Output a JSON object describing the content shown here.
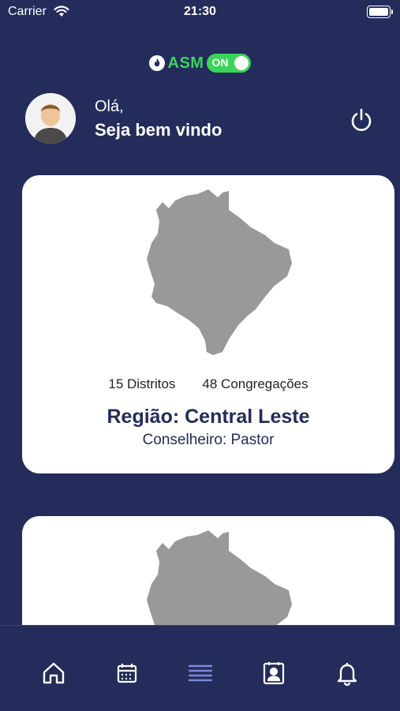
{
  "status_bar": {
    "carrier": "Carrier",
    "time": "21:30"
  },
  "brand": {
    "name": "ASM",
    "toggle_label": "ON",
    "accent": "#3bd45a"
  },
  "greeting": {
    "hello": "Olá,",
    "welcome": "Seja bem vindo"
  },
  "regions": [
    {
      "districts": "15 Distritos",
      "congregations": "48 Congregações",
      "region": "Região: Central Leste",
      "counselor": "Conselheiro: Pastor"
    }
  ],
  "tabs": [
    {
      "icon": "home-icon",
      "active": false
    },
    {
      "icon": "calendar-icon",
      "active": false
    },
    {
      "icon": "list-icon",
      "active": true
    },
    {
      "icon": "contact-book-icon",
      "active": false
    },
    {
      "icon": "bell-icon",
      "active": false
    }
  ],
  "colors": {
    "background": "#232c5a",
    "card": "#ffffff",
    "map": "#999999",
    "active_tab": "#7c88d8"
  }
}
